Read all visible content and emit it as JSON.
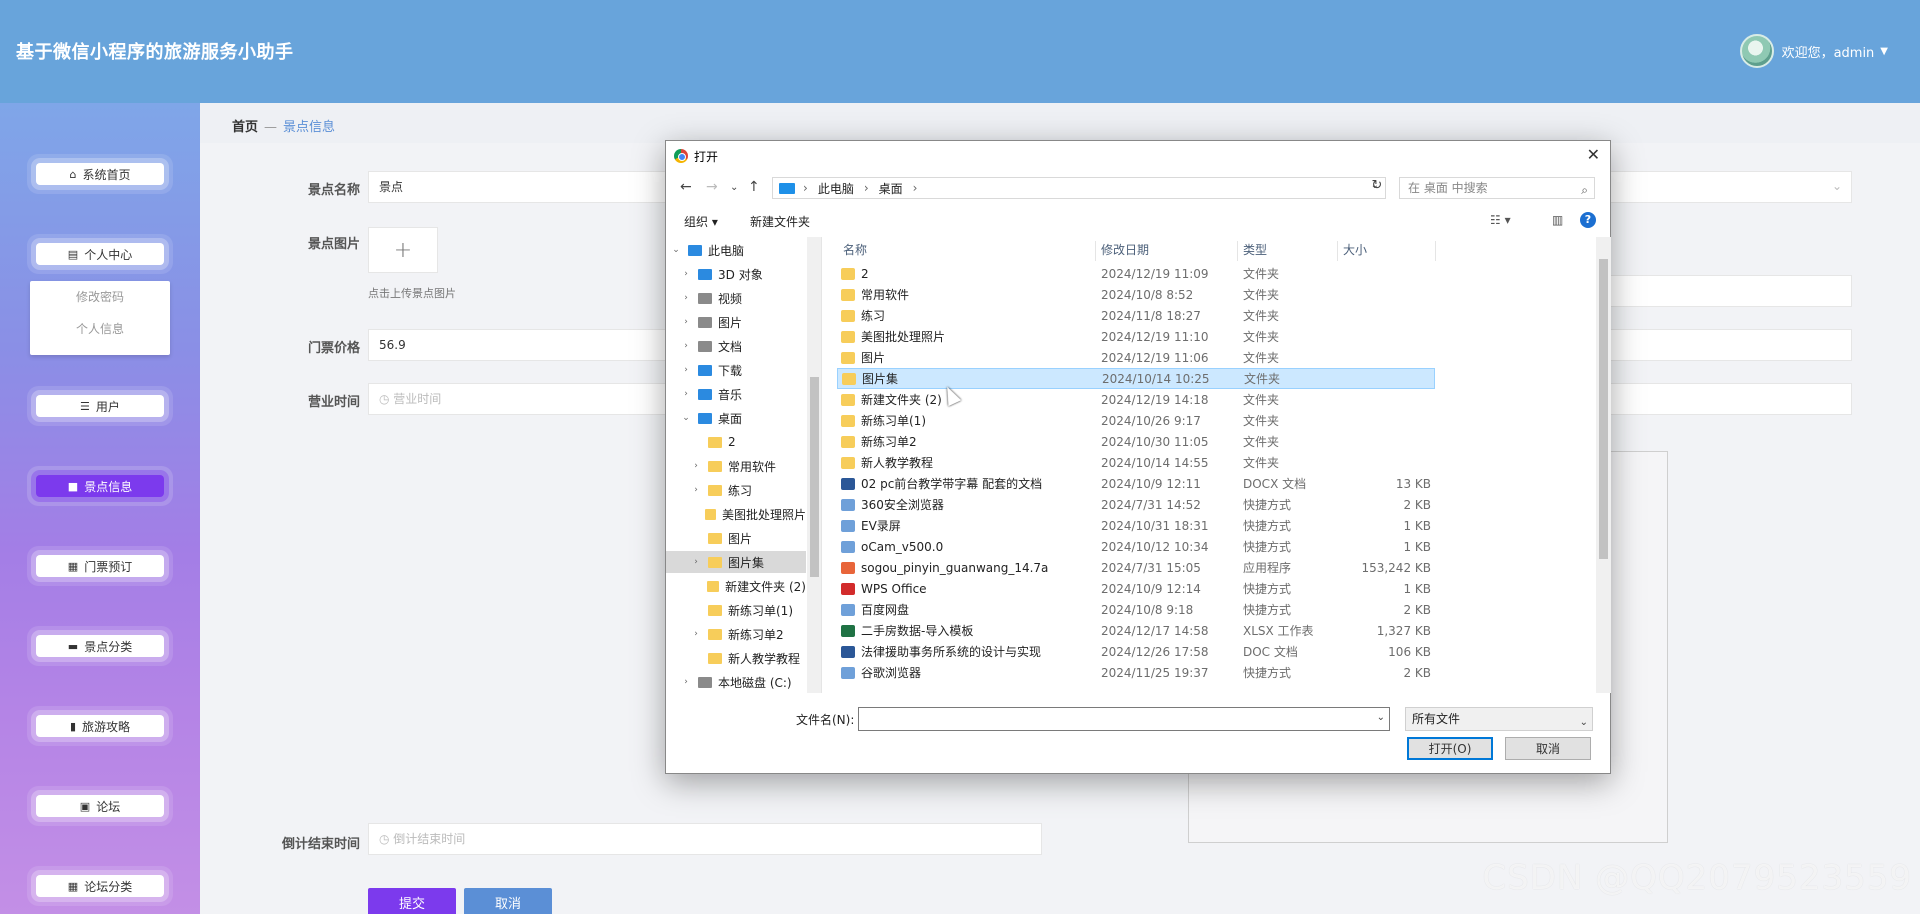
{
  "app": {
    "title": "基于微信小程序的旅游服务小助手",
    "welcome": "欢迎您，admin"
  },
  "sidebar": {
    "items": [
      {
        "label": "系统首页",
        "icon": "home-icon"
      },
      {
        "label": "个人中心",
        "icon": "calendar-icon"
      },
      {
        "label": "用户",
        "icon": "sliders-icon"
      },
      {
        "label": "景点信息",
        "icon": "bookmark-icon",
        "active": true
      },
      {
        "label": "门票预订",
        "icon": "grid-icon"
      },
      {
        "label": "景点分类",
        "icon": "monitor-icon"
      },
      {
        "label": "旅游攻略",
        "icon": "bar-chart-icon"
      },
      {
        "label": "论坛",
        "icon": "clipboard-icon"
      },
      {
        "label": "论坛分类",
        "icon": "grid-icon"
      }
    ],
    "submenu": [
      "修改密码",
      "个人信息"
    ]
  },
  "breadcrumb": {
    "home": "首页",
    "sep": "—",
    "current": "景点信息"
  },
  "form": {
    "name_label": "景点名称",
    "name_value": "景点",
    "image_label": "景点图片",
    "upload_plus": "+",
    "upload_hint": "点击上传景点图片",
    "price_label": "门票价格",
    "price_value": "56.9",
    "hours_label": "营业时间",
    "hours_placeholder": "营业时间",
    "countdown_label": "倒计结束时间",
    "countdown_placeholder": "倒计结束时间",
    "submit": "提交",
    "cancel": "取消"
  },
  "dialog": {
    "title": "打开",
    "close": "✕",
    "path": [
      "此电脑",
      "桌面"
    ],
    "search_placeholder": "在 桌面 中搜索",
    "toolbar": {
      "organize": "组织 ▾",
      "new_folder": "新建文件夹"
    },
    "help": "?",
    "nav_tree": [
      {
        "label": "此电脑",
        "arrow": "v",
        "icon": "pc-icon",
        "indent": 0
      },
      {
        "label": "3D 对象",
        "arrow": ">",
        "icon": "3d-objects-icon",
        "indent": 1
      },
      {
        "label": "视频",
        "arrow": ">",
        "icon": "video-icon",
        "indent": 1
      },
      {
        "label": "图片",
        "arrow": ">",
        "icon": "pictures-icon",
        "indent": 1
      },
      {
        "label": "文档",
        "arrow": ">",
        "icon": "documents-icon",
        "indent": 1
      },
      {
        "label": "下载",
        "arrow": ">",
        "icon": "download-icon",
        "indent": 1
      },
      {
        "label": "音乐",
        "arrow": ">",
        "icon": "music-icon",
        "indent": 1
      },
      {
        "label": "桌面",
        "arrow": "v",
        "icon": "desktop-icon",
        "indent": 1
      },
      {
        "label": "2",
        "arrow": "",
        "icon": "folder-icon",
        "indent": 2
      },
      {
        "label": "常用软件",
        "arrow": ">",
        "icon": "folder-icon",
        "indent": 2
      },
      {
        "label": "练习",
        "arrow": ">",
        "icon": "folder-icon",
        "indent": 2
      },
      {
        "label": "美图批处理照片",
        "arrow": "",
        "icon": "folder-icon",
        "indent": 2
      },
      {
        "label": "图片",
        "arrow": "",
        "icon": "folder-icon",
        "indent": 2
      },
      {
        "label": "图片集",
        "arrow": ">",
        "icon": "folder-icon",
        "indent": 2,
        "selected": true
      },
      {
        "label": "新建文件夹 (2)",
        "arrow": "",
        "icon": "folder-icon",
        "indent": 2
      },
      {
        "label": "新练习单(1)",
        "arrow": "",
        "icon": "folder-icon",
        "indent": 2
      },
      {
        "label": "新练习单2",
        "arrow": ">",
        "icon": "folder-icon",
        "indent": 2
      },
      {
        "label": "新人教学教程",
        "arrow": "",
        "icon": "folder-icon",
        "indent": 2
      },
      {
        "label": "本地磁盘 (C:)",
        "arrow": ">",
        "icon": "drive-icon",
        "indent": 1
      }
    ],
    "columns": [
      "名称",
      "修改日期",
      "类型",
      "大小"
    ],
    "files": [
      {
        "name": "2",
        "date": "2024/12/19 11:09",
        "type": "文件夹",
        "size": "",
        "icon": "folder"
      },
      {
        "name": "常用软件",
        "date": "2024/10/8 8:52",
        "type": "文件夹",
        "size": "",
        "icon": "folder"
      },
      {
        "name": "练习",
        "date": "2024/11/8 18:27",
        "type": "文件夹",
        "size": "",
        "icon": "folder"
      },
      {
        "name": "美图批处理照片",
        "date": "2024/12/19 11:10",
        "type": "文件夹",
        "size": "",
        "icon": "folder"
      },
      {
        "name": "图片",
        "date": "2024/12/19 11:06",
        "type": "文件夹",
        "size": "",
        "icon": "folder"
      },
      {
        "name": "图片集",
        "date": "2024/10/14 10:25",
        "type": "文件夹",
        "size": "",
        "icon": "folder",
        "selected": true
      },
      {
        "name": "新建文件夹 (2)",
        "date": "2024/12/19 14:18",
        "type": "文件夹",
        "size": "",
        "icon": "folder"
      },
      {
        "name": "新练习单(1)",
        "date": "2024/10/26 9:17",
        "type": "文件夹",
        "size": "",
        "icon": "folder"
      },
      {
        "name": "新练习单2",
        "date": "2024/10/30 11:05",
        "type": "文件夹",
        "size": "",
        "icon": "folder"
      },
      {
        "name": "新人教学教程",
        "date": "2024/10/14 14:55",
        "type": "文件夹",
        "size": "",
        "icon": "folder"
      },
      {
        "name": "02 pc前台教学带字幕 配套的文档",
        "date": "2024/10/9 12:11",
        "type": "DOCX 文档",
        "size": "13 KB",
        "icon": "doc"
      },
      {
        "name": "360安全浏览器",
        "date": "2024/7/31 14:52",
        "type": "快捷方式",
        "size": "2 KB",
        "icon": "lnk"
      },
      {
        "name": "EV录屏",
        "date": "2024/10/31 18:31",
        "type": "快捷方式",
        "size": "1 KB",
        "icon": "lnk"
      },
      {
        "name": "oCam_v500.0",
        "date": "2024/10/12 10:34",
        "type": "快捷方式",
        "size": "1 KB",
        "icon": "lnk"
      },
      {
        "name": "sogou_pinyin_guanwang_14.7a",
        "date": "2024/7/31 15:05",
        "type": "应用程序",
        "size": "153,242 KB",
        "icon": "app"
      },
      {
        "name": "WPS Office",
        "date": "2024/10/9 12:14",
        "type": "快捷方式",
        "size": "1 KB",
        "icon": "wps"
      },
      {
        "name": "百度网盘",
        "date": "2024/10/8 9:18",
        "type": "快捷方式",
        "size": "2 KB",
        "icon": "lnk"
      },
      {
        "name": "二手房数据-导入模板",
        "date": "2024/12/17 14:58",
        "type": "XLSX 工作表",
        "size": "1,327 KB",
        "icon": "xls"
      },
      {
        "name": "法律援助事务所系统的设计与实现",
        "date": "2024/12/26 17:58",
        "type": "DOC 文档",
        "size": "106 KB",
        "icon": "doc"
      },
      {
        "name": "谷歌浏览器",
        "date": "2024/11/25 19:37",
        "type": "快捷方式",
        "size": "2 KB",
        "icon": "lnk"
      }
    ],
    "filename_label": "文件名(N):",
    "filename_value": "",
    "filetype": "所有文件",
    "open": "打开(O)",
    "cancel": "取消"
  },
  "watermark": "CSDN @QQ2079523559"
}
